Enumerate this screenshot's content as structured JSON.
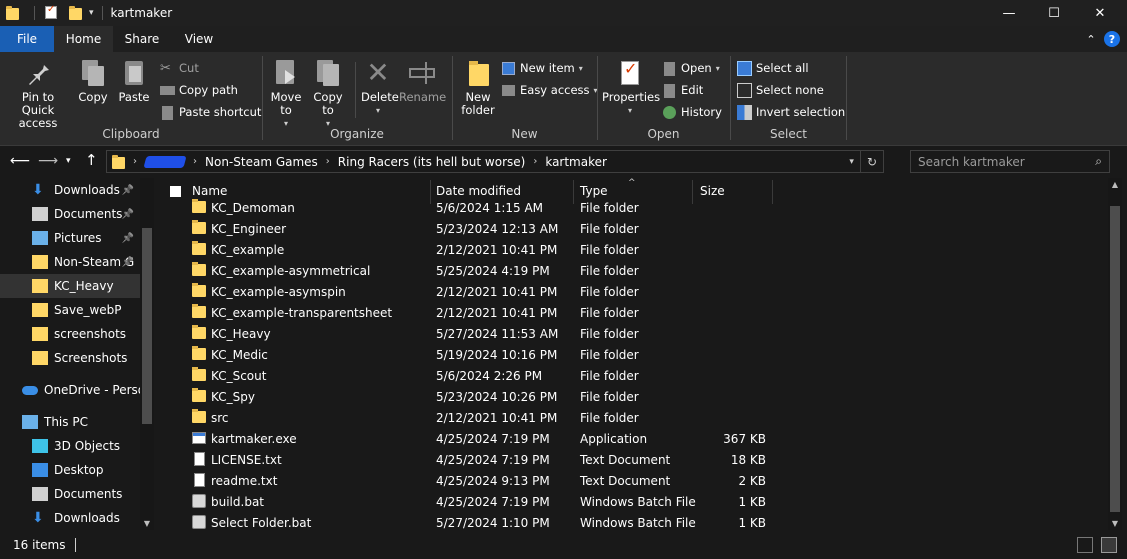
{
  "window": {
    "title": "kartmaker",
    "controls": {
      "minimize": "—",
      "maximize": "☐",
      "close": "✕"
    }
  },
  "ribbon_tabs": [
    "File",
    "Home",
    "Share",
    "View"
  ],
  "ribbon": {
    "clipboard": {
      "label": "Clipboard",
      "pin": "Pin to Quick access",
      "copy": "Copy",
      "paste": "Paste",
      "cut": "Cut",
      "copy_path": "Copy path",
      "paste_shortcut": "Paste shortcut"
    },
    "organize": {
      "label": "Organize",
      "move_to": "Move to",
      "copy_to": "Copy to",
      "delete": "Delete",
      "rename": "Rename"
    },
    "new": {
      "label": "New",
      "new_folder": "New folder",
      "new_item": "New item",
      "easy_access": "Easy access"
    },
    "open": {
      "label": "Open",
      "properties": "Properties",
      "open": "Open",
      "edit": "Edit",
      "history": "History"
    },
    "select": {
      "label": "Select",
      "select_all": "Select all",
      "select_none": "Select none",
      "invert": "Invert selection"
    }
  },
  "address": {
    "breadcrumbs": [
      "Non-Steam Games",
      "Ring Racers (its hell but worse)",
      "kartmaker"
    ],
    "search_placeholder": "Search kartmaker"
  },
  "nav_pane": [
    {
      "label": "Downloads",
      "icon": "download-arrow-icon",
      "pinned": true
    },
    {
      "label": "Documents",
      "icon": "documents-icon",
      "pinned": true
    },
    {
      "label": "Pictures",
      "icon": "pictures-icon",
      "pinned": true
    },
    {
      "label": "Non-Steam G",
      "icon": "folder-icon",
      "pinned": true
    },
    {
      "label": "KC_Heavy",
      "icon": "folder-icon",
      "selected": true
    },
    {
      "label": "Save_webP",
      "icon": "folder-icon"
    },
    {
      "label": "screenshots",
      "icon": "folder-icon"
    },
    {
      "label": "Screenshots",
      "icon": "folder-icon"
    },
    {
      "label": "OneDrive - Persor",
      "icon": "onedrive-cloud-icon"
    },
    {
      "label": "This PC",
      "icon": "computer-icon"
    },
    {
      "label": "3D Objects",
      "icon": "3d-objects-icon"
    },
    {
      "label": "Desktop",
      "icon": "desktop-icon"
    },
    {
      "label": "Documents",
      "icon": "documents-icon"
    },
    {
      "label": "Downloads",
      "icon": "download-arrow-icon"
    }
  ],
  "columns": {
    "name": "Name",
    "date": "Date modified",
    "type": "Type",
    "size": "Size"
  },
  "files": [
    {
      "name": "KC_Demoman",
      "date": "5/6/2024 1:15 AM",
      "type": "File folder",
      "size": "",
      "kind": "folder"
    },
    {
      "name": "KC_Engineer",
      "date": "5/23/2024 12:13 AM",
      "type": "File folder",
      "size": "",
      "kind": "folder"
    },
    {
      "name": "KC_example",
      "date": "2/12/2021 10:41 PM",
      "type": "File folder",
      "size": "",
      "kind": "folder"
    },
    {
      "name": "KC_example-asymmetrical",
      "date": "5/25/2024 4:19 PM",
      "type": "File folder",
      "size": "",
      "kind": "folder"
    },
    {
      "name": "KC_example-asymspin",
      "date": "2/12/2021 10:41 PM",
      "type": "File folder",
      "size": "",
      "kind": "folder"
    },
    {
      "name": "KC_example-transparentsheet",
      "date": "2/12/2021 10:41 PM",
      "type": "File folder",
      "size": "",
      "kind": "folder"
    },
    {
      "name": "KC_Heavy",
      "date": "5/27/2024 11:53 AM",
      "type": "File folder",
      "size": "",
      "kind": "folder"
    },
    {
      "name": "KC_Medic",
      "date": "5/19/2024 10:16 PM",
      "type": "File folder",
      "size": "",
      "kind": "folder"
    },
    {
      "name": "KC_Scout",
      "date": "5/6/2024 2:26 PM",
      "type": "File folder",
      "size": "",
      "kind": "folder"
    },
    {
      "name": "KC_Spy",
      "date": "5/23/2024 10:26 PM",
      "type": "File folder",
      "size": "",
      "kind": "folder"
    },
    {
      "name": "src",
      "date": "2/12/2021 10:41 PM",
      "type": "File folder",
      "size": "",
      "kind": "folder"
    },
    {
      "name": "kartmaker.exe",
      "date": "4/25/2024 7:19 PM",
      "type": "Application",
      "size": "367 KB",
      "kind": "app"
    },
    {
      "name": "LICENSE.txt",
      "date": "4/25/2024 7:19 PM",
      "type": "Text Document",
      "size": "18 KB",
      "kind": "txt"
    },
    {
      "name": "readme.txt",
      "date": "4/25/2024 9:13 PM",
      "type": "Text Document",
      "size": "2 KB",
      "kind": "txt"
    },
    {
      "name": "build.bat",
      "date": "4/25/2024 7:19 PM",
      "type": "Windows Batch File",
      "size": "1 KB",
      "kind": "bat"
    },
    {
      "name": "Select Folder.bat",
      "date": "5/27/2024 1:10 PM",
      "type": "Windows Batch File",
      "size": "1 KB",
      "kind": "bat"
    }
  ],
  "status": {
    "item_count": "16 items"
  },
  "colors": {
    "accent": "#1a5fb4",
    "folder": "#ffd766",
    "background": "#191919",
    "ribbon": "#2b2b2b"
  }
}
